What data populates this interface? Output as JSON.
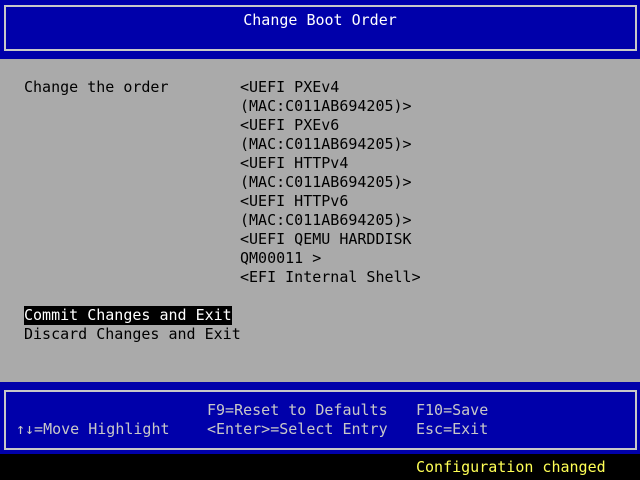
{
  "header": {
    "title": "Change Boot Order"
  },
  "form": {
    "label": "Change the order",
    "boot_order": [
      "<UEFI PXEv4",
      "(MAC:C011AB694205)>",
      "<UEFI PXEv6",
      "(MAC:C011AB694205)>",
      "<UEFI HTTPv4",
      "(MAC:C011AB694205)>",
      "<UEFI HTTPv6",
      "(MAC:C011AB694205)>",
      "<UEFI QEMU HARDDISK",
      "QM00011 >",
      "<EFI Internal Shell>"
    ],
    "actions": {
      "commit": "Commit Changes and Exit",
      "discard": "Discard Changes and Exit"
    }
  },
  "footer": {
    "f9": "F9=Reset to Defaults",
    "f10": "F10=Save",
    "move": "↑↓=Move Highlight",
    "enter": "<Enter>=Select Entry",
    "esc": "Esc=Exit"
  },
  "status": {
    "message": "Configuration changed"
  },
  "colors": {
    "header_bg": "#0000aa",
    "body_bg": "#aaaaaa",
    "highlight_bg": "#000000",
    "highlight_fg": "#ffffff",
    "status_fg": "#ffff55"
  }
}
